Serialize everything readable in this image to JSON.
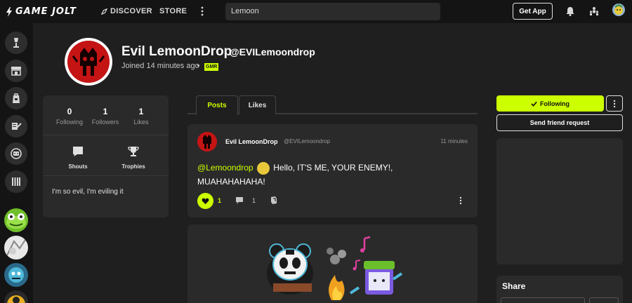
{
  "topbar": {
    "logo_text": "GAME JOLT",
    "discover_label": "DISCOVER",
    "store_label": "STORE",
    "search_value": "Lemoon",
    "get_app_label": "Get App"
  },
  "profile": {
    "display_name": "Evil LemoonDrop",
    "handle": "@EVILemoondrop",
    "joined": "Joined 14 minutes ago",
    "badge": "GMR"
  },
  "stats": [
    {
      "value": "0",
      "label": "Following"
    },
    {
      "value": "1",
      "label": "Followers"
    },
    {
      "value": "1",
      "label": "Likes"
    }
  ],
  "actions": {
    "shouts_label": "Shouts",
    "trophies_label": "Trophies"
  },
  "bio": "I'm so evil, I'm eviling it",
  "tabs": {
    "posts": "Posts",
    "likes": "Likes"
  },
  "post": {
    "author": "Evil LemoonDrop",
    "handle": "@EVILemoondrop",
    "time": "11 minutes",
    "mention": "@Lemoondrop",
    "text_line1": "Hello, IT'S ME, YOUR ENEMY!,",
    "text_line2": "MUAHAHAHAHA!",
    "like_count": "1",
    "comment_count": "1"
  },
  "sidebar_right": {
    "following_label": "Following",
    "friend_request_label": "Send friend request",
    "share_title": "Share"
  },
  "colors": {
    "accent": "#ccff00",
    "background": "#1f1f1f",
    "card": "#2a2a2a",
    "topbar": "#141414"
  }
}
